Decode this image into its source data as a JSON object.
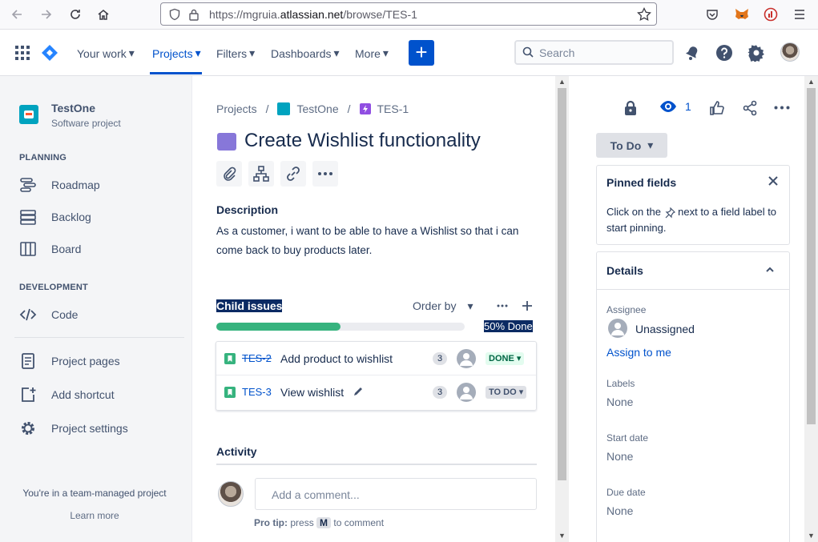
{
  "browser": {
    "url_prefix": "https://mgruia.",
    "url_domain": "atlassian.net",
    "url_path": "/browse/TES-1"
  },
  "topnav": {
    "your_work": "Your work",
    "projects": "Projects",
    "filters": "Filters",
    "dashboards": "Dashboards",
    "more": "More",
    "create": "+",
    "search_placeholder": "Search"
  },
  "sidebar": {
    "project_name": "TestOne",
    "project_type": "Software project",
    "planning_heading": "PLANNING",
    "roadmap": "Roadmap",
    "backlog": "Backlog",
    "board": "Board",
    "development_heading": "DEVELOPMENT",
    "code": "Code",
    "project_pages": "Project pages",
    "add_shortcut": "Add shortcut",
    "project_settings": "Project settings",
    "team_managed": "You're in a team-managed project",
    "learn_more": "Learn more"
  },
  "breadcrumb": {
    "projects": "Projects",
    "sep": "/",
    "project": "TestOne",
    "issue": "TES-1"
  },
  "issue": {
    "title": "Create Wishlist functionality",
    "description_heading": "Description",
    "description": "As a customer, i want to be able to have a Wishlist so that i can come back to buy products later.",
    "child_heading": "Child issues",
    "order_by": "Order by",
    "progress_label": "50% Done",
    "progress": 0.5,
    "children": [
      {
        "key": "TES-2",
        "summary": "Add product to wishlist",
        "points": "3",
        "status": "DONE",
        "status_color": "#006644",
        "status_bg": "#e3fcef"
      },
      {
        "key": "TES-3",
        "summary": "View wishlist",
        "points": "3",
        "status": "TO DO",
        "status_color": "#42526e",
        "status_bg": "#dfe1e6"
      }
    ],
    "activity_heading": "Activity",
    "comment_placeholder": "Add a comment...",
    "protip_label": "Pro tip:",
    "protip_press": "press",
    "protip_key": "M",
    "protip_rest": "to comment"
  },
  "right_panel": {
    "watch_count": "1",
    "status_button": "To Do",
    "pinned_heading": "Pinned fields",
    "pinned_text_1": "Click on the",
    "pinned_text_2": "next to a field label to start pinning.",
    "details_heading": "Details",
    "assignee_label": "Assignee",
    "assignee_value": "Unassigned",
    "assign_to_me": "Assign to me",
    "labels_label": "Labels",
    "labels_value": "None",
    "start_date_label": "Start date",
    "start_date_value": "None",
    "due_date_label": "Due date",
    "due_date_value": "None"
  },
  "colors": {
    "brand": "#0052cc",
    "progress": "#36b37e",
    "epic": "#8777d9"
  }
}
